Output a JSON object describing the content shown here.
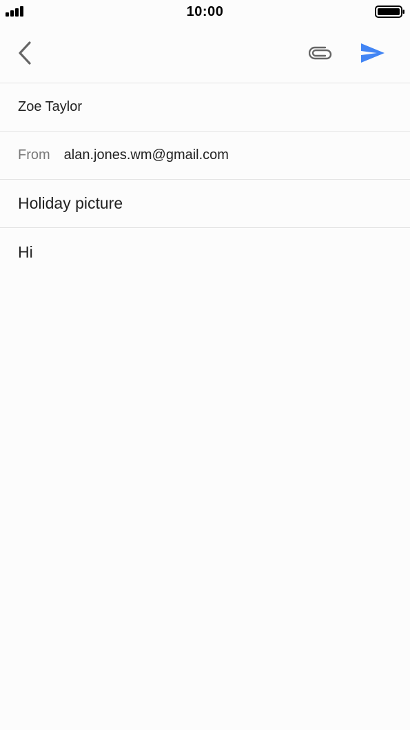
{
  "status_bar": {
    "time": "10:00",
    "signal_icon": "cellular-signal-icon",
    "battery_icon": "battery-full-icon"
  },
  "toolbar": {
    "back_icon": "chevron-left-icon",
    "attach_icon": "paperclip-icon",
    "send_icon": "send-icon"
  },
  "compose": {
    "to": "Zoe Taylor",
    "from_label": "From",
    "from": "alan.jones.wm@gmail.com",
    "subject": "Holiday picture",
    "body": "Hi"
  },
  "colors": {
    "accent": "#4285f4",
    "icon_gray": "#666666",
    "divider": "#e4e4e4",
    "background": "#fcfcfc"
  }
}
